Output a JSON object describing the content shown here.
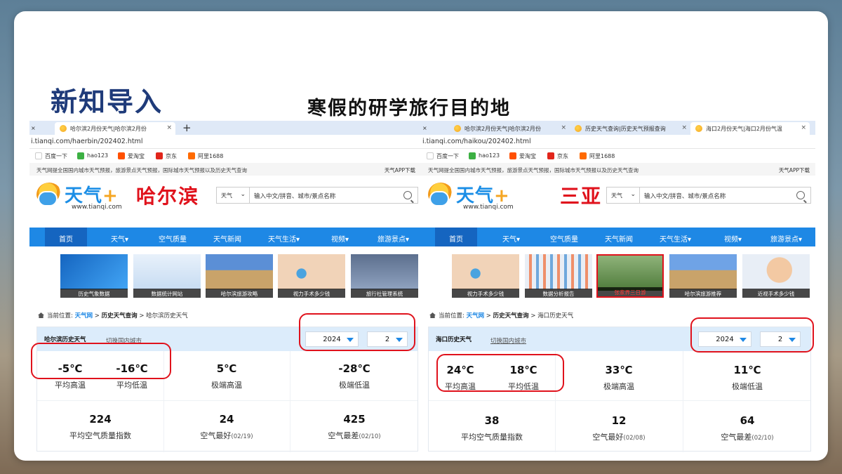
{
  "slide": {
    "title": "新知导入",
    "subtitle": "寒假的研学旅行目的地"
  },
  "colors": {
    "accent": "#1e88e5",
    "highlight": "#e0121c",
    "title": "#1f3b7a"
  },
  "left": {
    "tabs": [
      {
        "label": "哈尔滨2月份天气|哈尔滨2月份",
        "active": true
      }
    ],
    "url": "i.tianqi.com/haerbin/202402.html",
    "bookmarks": [
      "百度一下",
      "hao123",
      "爱淘宝",
      "京东",
      "阿里1688"
    ],
    "notice": "天气网提全国国内城市天气预报，旅游景点天气预报，国际城市天气预报以及历史天气查询",
    "app_download": "天气APP下载",
    "logo_text": "天气",
    "logo_plus": "+",
    "logo_url": "www.tianqi.com",
    "city": "哈尔滨",
    "search": {
      "type": "天气",
      "placeholder": "输入中文/拼音、城市/景点名称"
    },
    "nav": [
      "首页",
      "天气▾",
      "空气质量",
      "天气新闻",
      "天气生活▾",
      "视频▾",
      "旅游景点▾"
    ],
    "thumbs": [
      "历史气象数据",
      "数据统计网站",
      "哈尔滨旅游攻略",
      "视力手术多少钱",
      "旅行社管理系统"
    ],
    "breadcrumb": {
      "prefix": "当前位置:",
      "home": "天气网",
      "sep": ">",
      "mid": "历史天气查询",
      "current": "哈尔滨历史天气"
    },
    "card": {
      "title": "哈尔滨历史天气",
      "link": "切换国内城市",
      "year": "2024",
      "month": "2",
      "row1": [
        {
          "value": "-5℃",
          "label": "平均高温"
        },
        {
          "value": "-16℃",
          "label": "平均低温"
        },
        {
          "value": "5℃",
          "label": "极端高温"
        },
        {
          "value": "-28℃",
          "label": "极端低温"
        }
      ],
      "row2": [
        {
          "value": "224",
          "label": "平均空气质量指数",
          "date": ""
        },
        {
          "value": "24",
          "label": "空气最好",
          "date": "(02/19)"
        },
        {
          "value": "425",
          "label": "空气最差",
          "date": "(02/10)"
        }
      ]
    }
  },
  "right": {
    "tab_frag": "",
    "tabs": [
      {
        "label": "哈尔滨2月份天气|哈尔滨2月份",
        "active": false
      },
      {
        "label": "历史天气查询|历史天气预报查询",
        "active": false
      },
      {
        "label": "海口2月份天气|海口2月份气温",
        "active": true
      }
    ],
    "url": "i.tianqi.com/haikou/202402.html",
    "bookmarks": [
      "百度一下",
      "hao123",
      "爱淘宝",
      "京东",
      "阿里1688"
    ],
    "notice": "天气网提全国国内城市天气预报，旅游景点天气预报，国际城市天气预报以及历史天气查询",
    "app_download": "天气APP下载",
    "logo_text": "天气",
    "logo_plus": "+",
    "logo_url": "www.tianqi.com",
    "city": "三亚",
    "search": {
      "type": "天气",
      "placeholder": "输入中文/拼音、城市/景点名称"
    },
    "nav": [
      "首页",
      "天气▾",
      "空气质量",
      "天气新闻",
      "天气生活▾",
      "视频▾",
      "旅游景点▾"
    ],
    "thumbs": [
      "视力手术多少钱",
      "数据分析报告",
      "张家界三日游",
      "哈尔滨旅游推荐",
      "近视手术多少钱"
    ],
    "breadcrumb": {
      "prefix": "当前位置:",
      "home": "天气网",
      "sep": ">",
      "mid": "历史天气查询",
      "current": "海口历史天气"
    },
    "card": {
      "title": "海口历史天气",
      "link": "切换国内城市",
      "year": "2024",
      "month": "2",
      "row1": [
        {
          "value": "24℃",
          "label": "平均高温"
        },
        {
          "value": "18℃",
          "label": "平均低温"
        },
        {
          "value": "33℃",
          "label": "极端高温"
        },
        {
          "value": "11℃",
          "label": "极端低温"
        }
      ],
      "row2": [
        {
          "value": "38",
          "label": "平均空气质量指数",
          "date": ""
        },
        {
          "value": "12",
          "label": "空气最好",
          "date": "(02/08)"
        },
        {
          "value": "64",
          "label": "空气最差",
          "date": "(02/10)"
        }
      ]
    }
  }
}
